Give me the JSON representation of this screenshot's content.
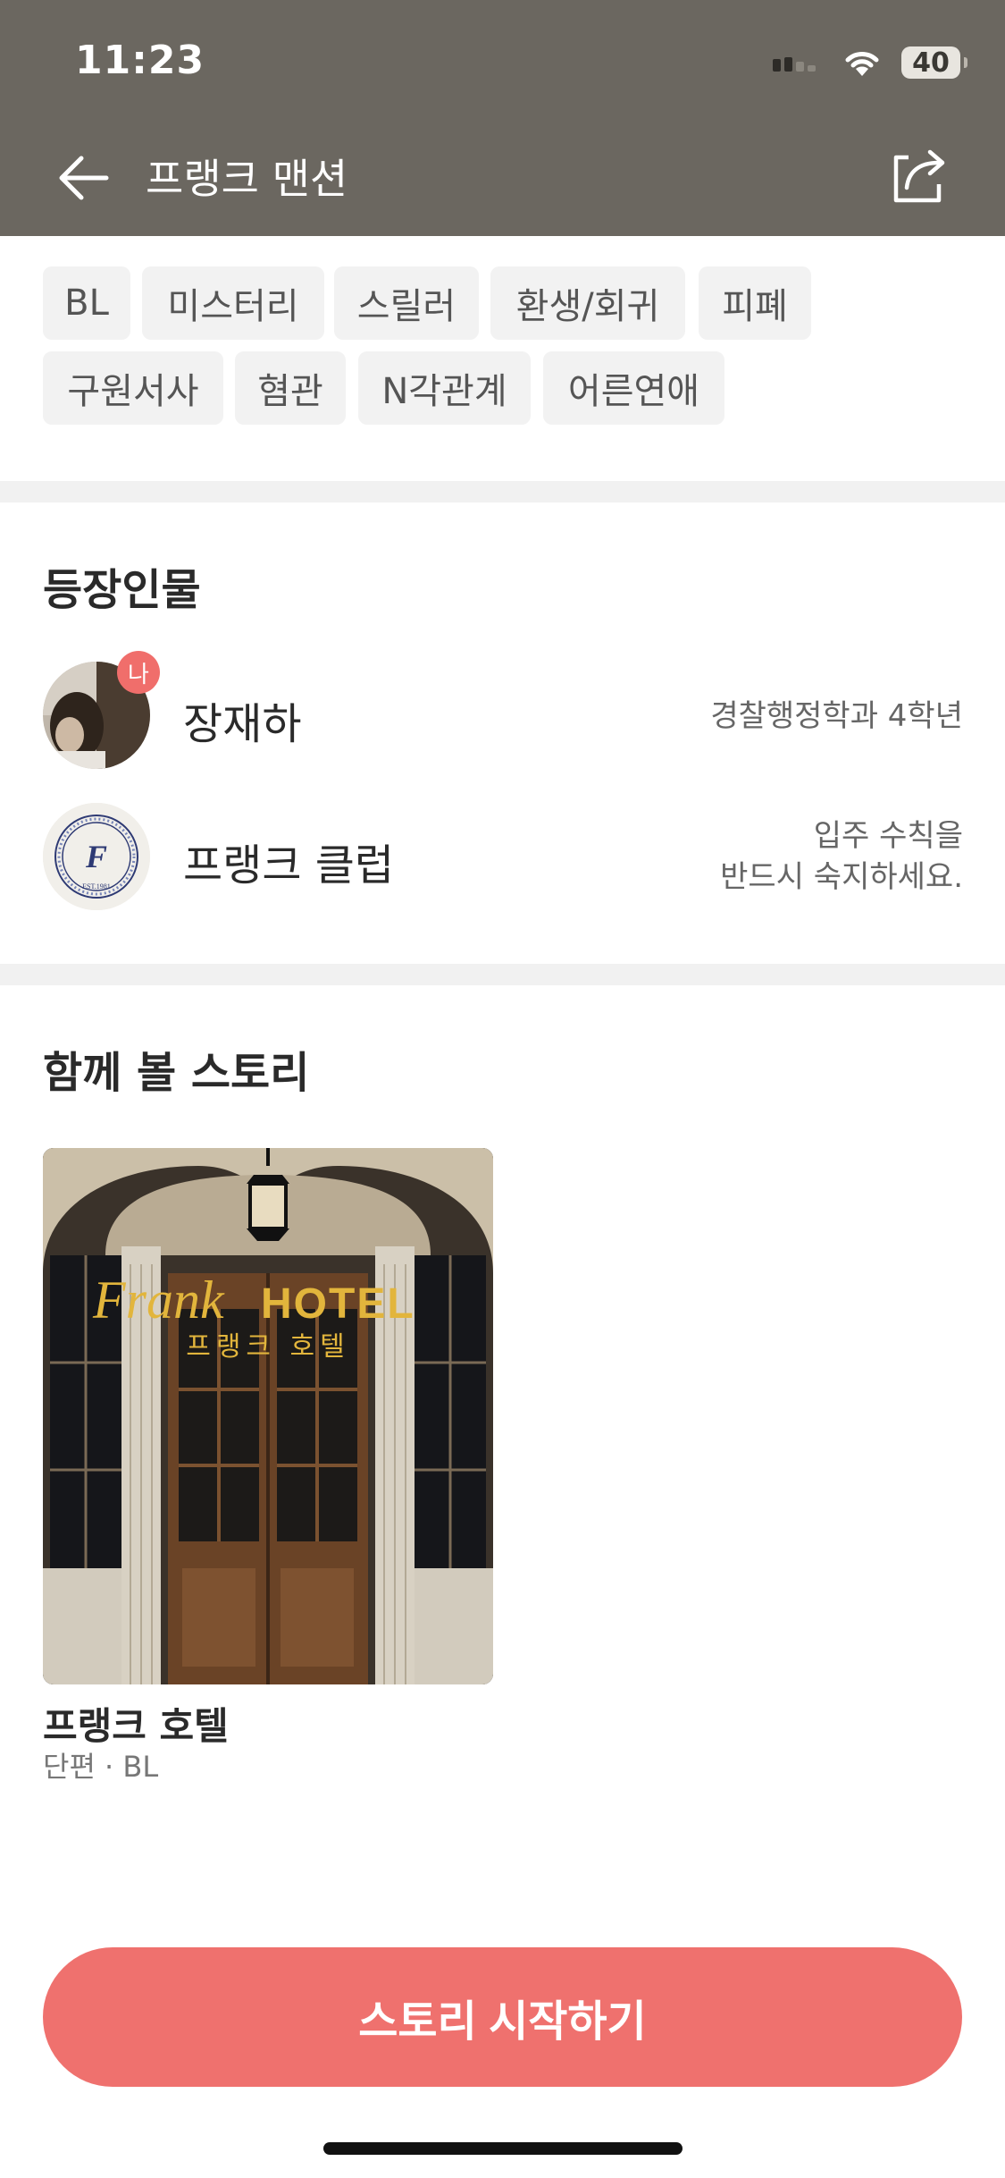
{
  "status_bar": {
    "time": "11:23",
    "battery": "40"
  },
  "header": {
    "title": "프랭크 맨션",
    "back_icon": "arrow-left-icon",
    "share_icon": "share-icon"
  },
  "tags": [
    "BL",
    "미스터리",
    "스릴러",
    "환생/회귀",
    "피폐",
    "구원서사",
    "혐관",
    "N각관계",
    "어른연애"
  ],
  "characters_section": {
    "title": "등장인물",
    "items": [
      {
        "name": "장재하",
        "badge": "나",
        "desc_line1": "경찰행정학과 4학년",
        "desc_line2": ""
      },
      {
        "name": "프랭크 클럽",
        "badge": "",
        "desc_line1": "입주 수칙을",
        "desc_line2": "반드시 숙지하세요.",
        "logo_letter": "F",
        "logo_ring_text": "EST.1981"
      }
    ]
  },
  "stories_section": {
    "title": "함께 볼 스토리",
    "items": [
      {
        "title": "프랭크 호텔",
        "meta": "단편 · BL",
        "cover_text_en1": "Frank",
        "cover_text_en2": "HOTEL",
        "cover_text_ko": "프랭크 호텔"
      }
    ]
  },
  "start_button": {
    "label": "스토리 시작하기"
  },
  "colors": {
    "header_bg": "#6b6760",
    "accent": "#ef716e",
    "tag_bg": "#f2f2f2",
    "divider": "#f1f1f1",
    "cover_gold": "#e2b53c"
  }
}
